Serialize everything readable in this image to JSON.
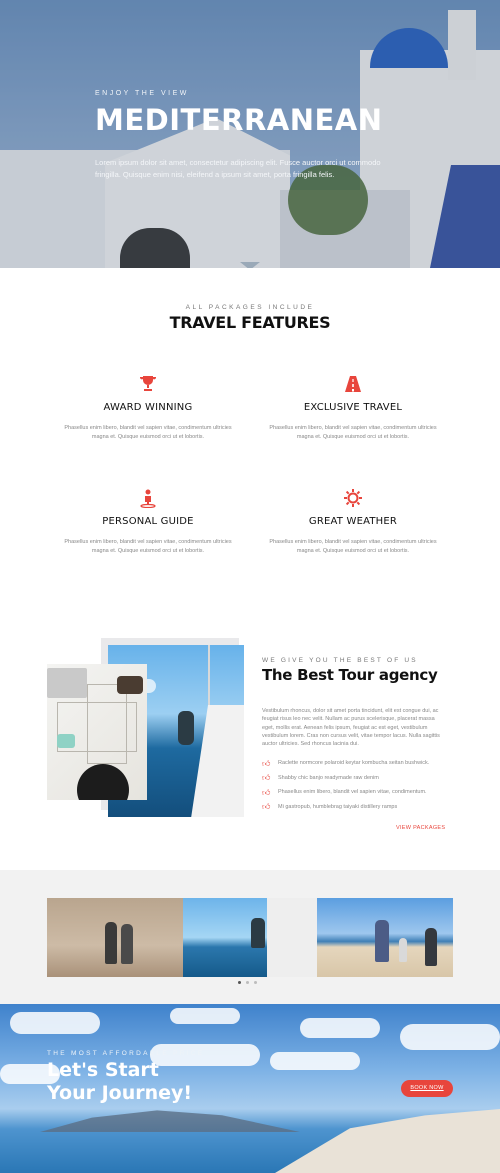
{
  "hero": {
    "eyebrow": "ENJOY THE VIEW",
    "title": "MEDITERRANEAN",
    "text": "Lorem ipsum dolor sit amet, consectetur adipiscing elit. Fusce auctor orci ut commodo fringilla. Quisque enim nisi, eleifend a ipsum sit amet, porta fringilla felis."
  },
  "features": {
    "eyebrow": "ALL PACKAGES INCLUDE",
    "title": "TRAVEL FEATURES",
    "items": [
      {
        "icon": "trophy-icon",
        "title": "AWARD WINNING",
        "text": "Phasellus enim libero, blandit vel sapien vitae, condimentum ultricies magna et. Quisque euismod orci ut et lobortis."
      },
      {
        "icon": "road-icon",
        "title": "EXCLUSIVE TRAVEL",
        "text": "Phasellus enim libero, blandit vel sapien vitae, condimentum ultricies magna et. Quisque euismod orci ut et lobortis."
      },
      {
        "icon": "location-person-icon",
        "title": "PERSONAL GUIDE",
        "text": "Phasellus enim libero, blandit vel sapien vitae, condimentum ultricies magna et. Quisque euismod orci ut et lobortis."
      },
      {
        "icon": "sun-icon",
        "title": "GREAT WEATHER",
        "text": "Phasellus enim libero, blandit vel sapien vitae, condimentum ultricies magna et. Quisque euismod orci ut et lobortis."
      }
    ]
  },
  "agency": {
    "eyebrow": "WE GIVE YOU THE BEST OF US",
    "title": "The Best Tour agency",
    "text": "Vestibulum rhoncus, dolor sit amet porta tincidunt, elit est congue dui, ac feugiat risus leo nec velit. Nullam ac purus scelerisque, placerat massa eget, mollis erat. Aenean felis ipsum, feugiat ac est eget, vestibulum vestibulum lorem. Cras non cursus velit, vitae tempor lacus. Nulla sagittis auctor ultricies. Sed rhoncus lacinia dui.",
    "list": [
      "Raclette normcore polaroid keytar kombucha seitan bushwick.",
      "Shabby chic banjo readymade raw denim",
      "Phasellus enim libero, blandit vel sapien vitae, condimentum.",
      "Mi gastropub, humblebrag taiyaki distillery ramps"
    ],
    "link": "VIEW PACKAGES"
  },
  "gallery": {
    "slides": 3,
    "active": 1
  },
  "cta": {
    "eyebrow": "THE MOST AFFORDABLE PRICE",
    "title_line1": "Let's Start",
    "title_line2": "Your Journey!",
    "button": "BOOK NOW"
  },
  "colors": {
    "accent": "#e8453c",
    "heading": "#111111",
    "body": "#888888",
    "band": "#f2f2f2"
  }
}
